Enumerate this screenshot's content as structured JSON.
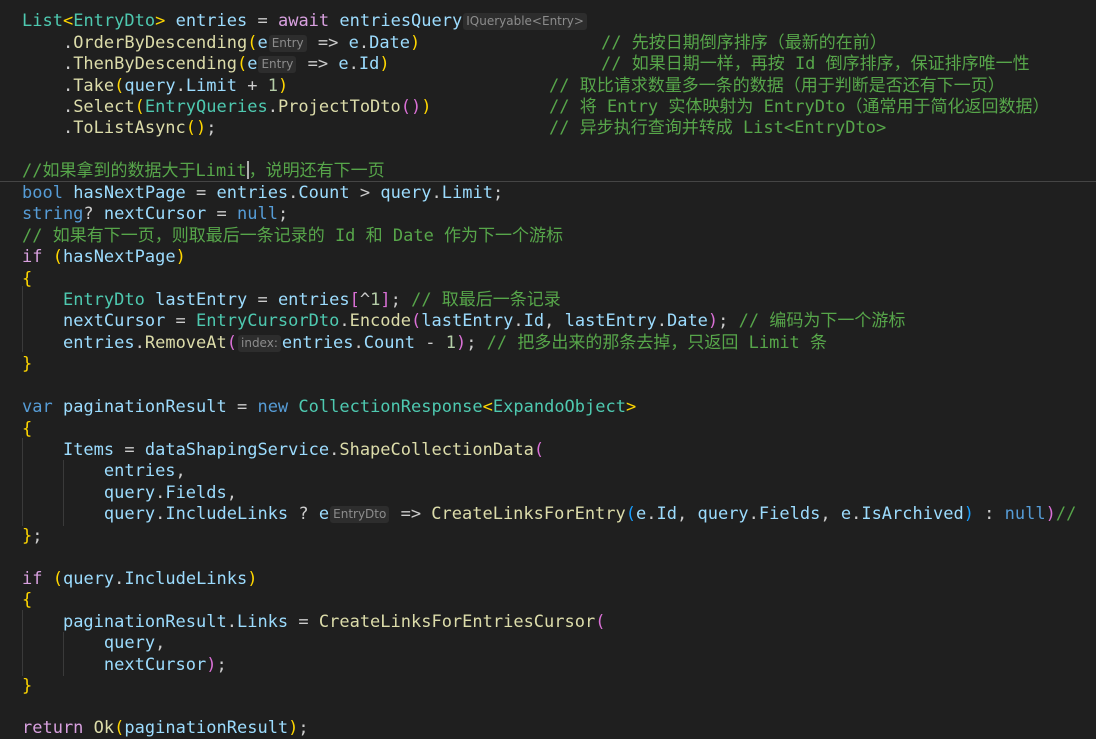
{
  "colors": {
    "background": "#1f1f1f",
    "comment": "#57a64a",
    "keyword": "#569cd6",
    "control_keyword": "#d8a0df",
    "type": "#4ec9b0",
    "method": "#dcdcaa",
    "variable": "#9cdcfe",
    "number": "#b5cea8",
    "bracket_gold": "#ffd700",
    "bracket_orchid": "#da70d6",
    "bracket_blue": "#179fff",
    "inlay_hint": "#8c8c8c"
  },
  "hints": {
    "entries_type": "IQueryable<Entry>",
    "lambda_param_entry": "Entry",
    "lambda_param_entry_dto": "EntryDto",
    "removeat_param": "index:"
  },
  "comments": {
    "order_by_date": "// 先按日期倒序排序（最新的在前）",
    "then_by_id": "// 如果日期一样，再按 Id 倒序排序，保证排序唯一性",
    "take_extra": "// 取比请求数量多一条的数据（用于判断是否还有下一页）",
    "select_dto": "// 将 Entry 实体映射为 EntryDto（通常用于简化返回数据）",
    "to_list": "// 异步执行查询并转成 List<EntryDto>",
    "if_more_part1": "//如果拿到的数据大于Limit",
    "if_more_part2": "，说明还有下一页",
    "use_last_as_cursor": "// 如果有下一页，则取最后一条记录的 Id 和 Date 作为下一个游标",
    "take_last": "// 取最后一条记录",
    "encode_cursor": "// 编码为下一个游标",
    "remove_extra": "// 把多出来的那条去掉，只返回 Limit 条",
    "trailing_slashes": "//"
  }
}
